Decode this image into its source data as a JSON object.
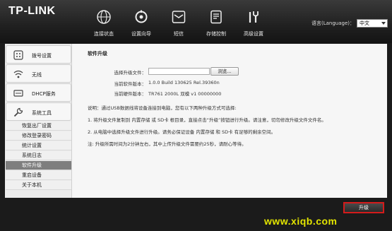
{
  "header": {
    "logo": "TP-LINK",
    "nav": [
      {
        "label": "连接状态",
        "icon": "globe-icon"
      },
      {
        "label": "设置向导",
        "icon": "wizard-icon"
      },
      {
        "label": "短信",
        "icon": "mail-icon"
      },
      {
        "label": "存储控制",
        "icon": "storage-icon"
      },
      {
        "label": "高级设置",
        "icon": "tools-icon"
      }
    ],
    "language_label": "语言(Language)：",
    "language_value": "中文"
  },
  "sidebar": {
    "groups": [
      {
        "label": "拨号设置",
        "icon": "dialup-icon"
      },
      {
        "label": "无线",
        "icon": "wifi-icon"
      },
      {
        "label": "DHCP服务",
        "icon": "dhcp-icon"
      },
      {
        "label": "系统工具",
        "icon": "wrench-icon"
      }
    ],
    "items": [
      "恢复出厂设置",
      "修改登录密码",
      "统计设置",
      "系统日志",
      "软件升级",
      "重启设备",
      "关于本机"
    ],
    "active_item": "软件升级"
  },
  "content": {
    "title": "软件升级",
    "file_label": "选择升级文件：",
    "browse_label": "浏览...",
    "sw_label": "当前软件版本：",
    "sw_value": "1.0.0 Build 130625 Rel.39360n",
    "hw_label": "当前硬件版本：",
    "hw_value": "TR761 2000L 双模 v1 00000000",
    "note_intro": "说明：通过USB数据线将设备连接到电脑，您有以下两种升级方式可选择:",
    "note_1": "1. 将升级文件复制到 内置存储 或 SD卡 根目录，直接点击“升级”按钮进行升级。请注意，切勿修改升级文件文件名。",
    "note_2": "2. 从电脑中选择升级文件进行升级。请务必保证设备 内置存储 和 SD卡 有足够的剩余空间。",
    "note_3": "注: 升级所需时间为2分钟左右，其中上传升级文件需要约25秒，请耐心等待。"
  },
  "footer": {
    "upgrade_button": "升级",
    "watermark": "www.xiqb.com"
  },
  "colors": {
    "header_bg": "#202020",
    "active_item_bg": "#7e7e7e",
    "upgrade_border": "#d41b1b",
    "watermark": "#e3e500"
  }
}
